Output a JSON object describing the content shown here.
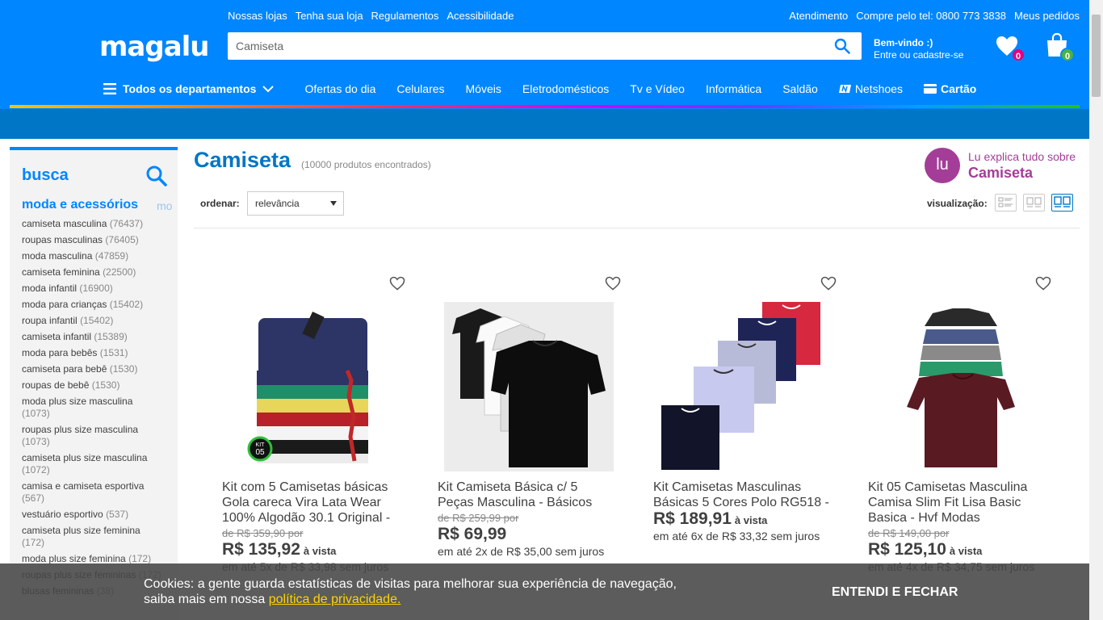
{
  "header": {
    "top_links": [
      "Nossas lojas",
      "Tenha sua loja",
      "Regulamentos",
      "Acessibilidade"
    ],
    "top_right": [
      "Atendimento",
      "Compre pelo tel: 0800 773 3838",
      "Meus pedidos"
    ],
    "logo": "magalu",
    "search_value": "Camiseta",
    "welcome_title": "Bem-vindo :)",
    "welcome_sub": "Entre ou cadastre-se",
    "wishlist_count": "0",
    "cart_count": "0",
    "nav": {
      "departments": "Todos os departamentos",
      "items": [
        "Ofertas do dia",
        "Celulares",
        "Móveis",
        "Eletrodomésticos",
        "Tv e Vídeo",
        "Informática",
        "Saldão"
      ],
      "netshoes": "Netshoes",
      "cartao": "Cartão"
    }
  },
  "sidebar": {
    "title": "busca",
    "category": "moda e acessórios",
    "category_next": "mo",
    "items": [
      {
        "label": "camiseta masculina",
        "count": "(76437)"
      },
      {
        "label": "roupas masculinas",
        "count": "(76405)"
      },
      {
        "label": "moda masculina",
        "count": "(47859)"
      },
      {
        "label": "camiseta feminina",
        "count": "(22500)"
      },
      {
        "label": "moda infantil",
        "count": "(16900)"
      },
      {
        "label": "moda para crianças",
        "count": "(15402)"
      },
      {
        "label": "roupa infantil",
        "count": "(15402)"
      },
      {
        "label": "camiseta infantil",
        "count": "(15389)"
      },
      {
        "label": "moda para bebês",
        "count": "(1531)"
      },
      {
        "label": "camiseta para bebê",
        "count": "(1530)"
      },
      {
        "label": "roupas de bebê",
        "count": "(1530)"
      },
      {
        "label": "moda plus size masculina",
        "count": "(1073)"
      },
      {
        "label": "roupas plus size masculina",
        "count": "(1073)"
      },
      {
        "label": "camiseta plus size masculina",
        "count": "(1072)"
      },
      {
        "label": "camisa e camiseta esportiva",
        "count": "(567)"
      },
      {
        "label": "vestuário esportivo",
        "count": "(537)"
      },
      {
        "label": "camiseta plus size feminina",
        "count": "(172)"
      },
      {
        "label": "moda plus size feminina",
        "count": "(172)"
      },
      {
        "label": "roupas plus size femininas",
        "count": "(172)"
      },
      {
        "label": "blusas femininas",
        "count": "(38)"
      }
    ]
  },
  "main": {
    "title": "Camiseta",
    "count": "(10000 produtos encontrados)",
    "lu_icon": "lu",
    "lu_line1": "Lu explica tudo sobre",
    "lu_line2": "Camiseta",
    "sort_label": "ordenar:",
    "sort_value": "relevância",
    "view_label": "visualização:"
  },
  "products": [
    {
      "name": "Kit com 5 Camisetas básicas Gola careca Vira Lata Wear 100% Algodão 30.1 Original -",
      "old": "de R$ 359,90 por",
      "price": "R$ 135,92",
      "avista": "à vista",
      "inst": "em até 5x de R$ 33,98 sem juros",
      "kit_label": "KIT",
      "kit_number": "05"
    },
    {
      "name": "Kit Camiseta Básica c/ 5 Peças Masculina - Básicos",
      "old": "de R$ 259,99 por",
      "price": "R$ 69,99",
      "avista": "",
      "inst": "em até 2x de R$ 35,00 sem juros"
    },
    {
      "name": "Kit Camisetas Masculinas Básicas 5 Cores Polo RG518 -",
      "old": "",
      "price": "R$ 189,91",
      "avista": "à vista",
      "inst": "em até 6x de R$ 33,32 sem juros"
    },
    {
      "name": "Kit 05 Camisetas Masculina Camisa Slim Fit Lisa Basic Basica - Hvf Modas",
      "old": "de R$ 149,00 por",
      "price": "R$ 125,10",
      "avista": "à vista",
      "inst": "em até 4x de R$ 34,75 sem juros"
    }
  ],
  "cookie": {
    "text": "Cookies: a gente guarda estatísticas de visitas para melhorar sua experiência de navegação, saiba mais em nossa",
    "link": "política de privacidade.",
    "button": "ENTENDI E FECHAR"
  },
  "colors": {
    "brand_blue": "#0086ff",
    "dark_blue": "#0076c6",
    "lu_purple": "#a43d98",
    "badge_pink": "#e5007e",
    "badge_green": "#4db23f"
  }
}
